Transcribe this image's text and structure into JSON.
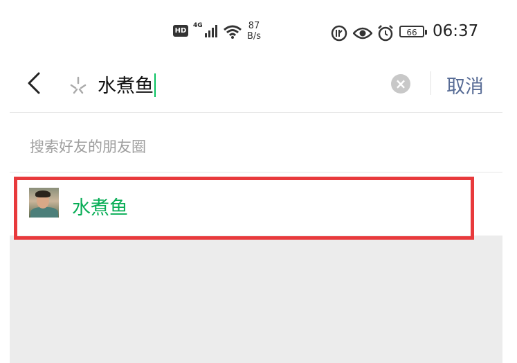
{
  "status_bar": {
    "hd": "HD",
    "network": "4G",
    "speed_value": "87",
    "speed_unit": "B/s",
    "battery": "66",
    "time": "06:37"
  },
  "search": {
    "query": "水煮鱼",
    "cancel_label": "取消"
  },
  "section": {
    "title": "搜索好友的朋友圈"
  },
  "results": [
    {
      "name": "水煮鱼"
    }
  ],
  "colors": {
    "accent_green": "#07c160",
    "result_green": "#07ad55",
    "cancel_blue": "#576b95",
    "highlight_red": "#e83a3c"
  }
}
